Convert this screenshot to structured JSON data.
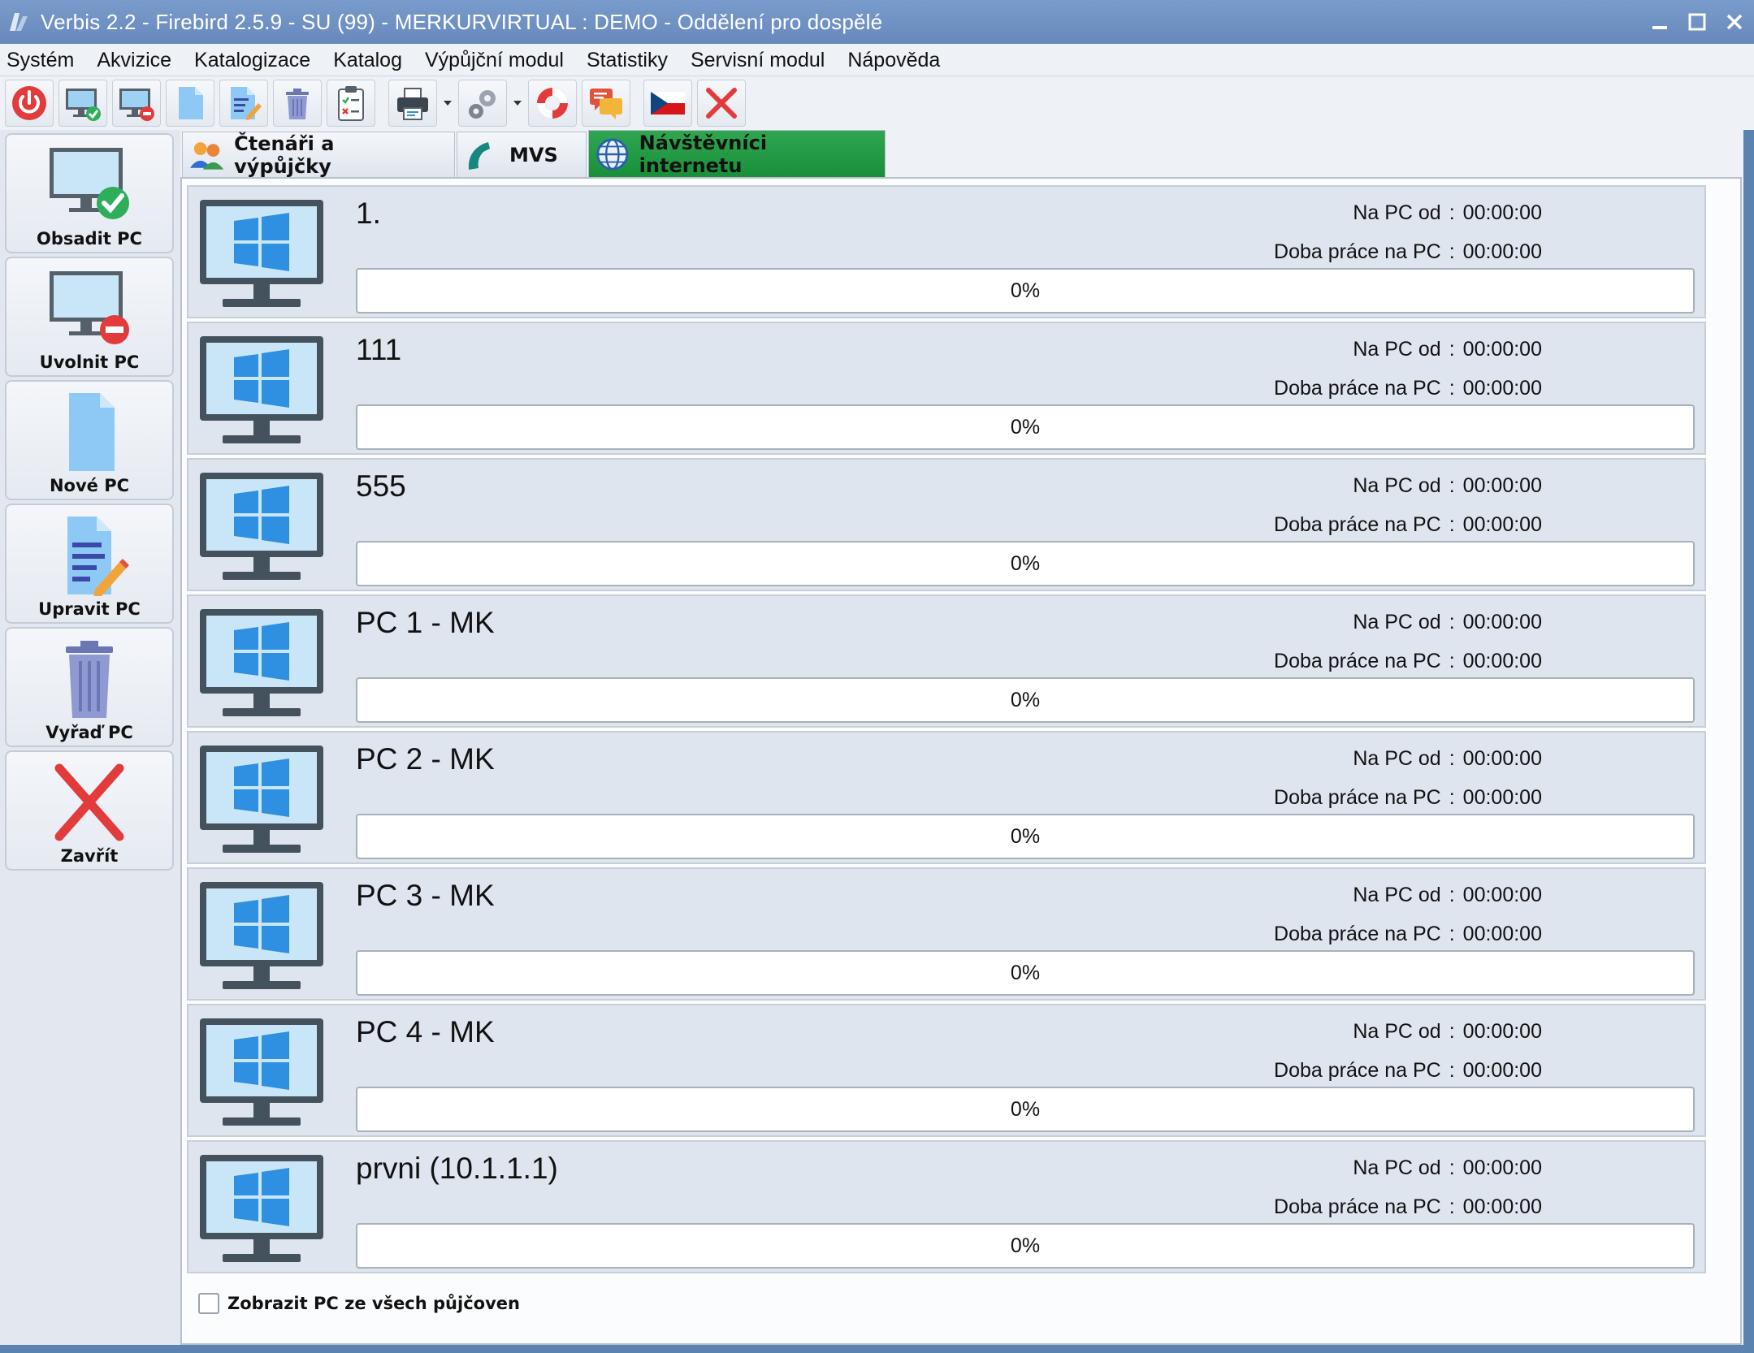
{
  "window": {
    "title": "Verbis 2.2 - Firebird 2.5.9 - SU (99) - MERKURVIRTUAL : DEMO - Oddělení pro dospělé"
  },
  "menu": [
    "Systém",
    "Akvizice",
    "Katalogizace",
    "Katalog",
    "Výpůjční modul",
    "Statistiky",
    "Servisní modul",
    "Nápověda"
  ],
  "toolbar_icons": [
    "power-icon",
    "monitor-ok-icon",
    "monitor-remove-icon",
    "new-document-icon",
    "edit-document-icon",
    "trash-icon",
    "clipboard-icon",
    "printer-icon",
    "settings-gear-icon",
    "lifebuoy-icon",
    "chat-icon",
    "czech-flag-icon",
    "close-red-x-icon"
  ],
  "sidebar": {
    "buttons": [
      {
        "label": "Obsadit PC",
        "icon": "monitor-check-icon"
      },
      {
        "label": "Uvolnit PC",
        "icon": "monitor-stop-icon"
      },
      {
        "label": "Nové PC",
        "icon": "new-document-icon"
      },
      {
        "label": "Upravit PC",
        "icon": "edit-document-icon"
      },
      {
        "label": "Vyřaď PC",
        "icon": "trash-icon"
      },
      {
        "label": "Zavřít",
        "icon": "close-red-x-icon"
      }
    ]
  },
  "tabs": [
    {
      "label": "Čtenáři a výpůjčky",
      "icon": "readers-icon",
      "active": false
    },
    {
      "label": "MVS",
      "icon": "phone-icon",
      "active": false
    },
    {
      "label": "Návštěvníci internetu",
      "icon": "globe-icon",
      "active": true
    }
  ],
  "pc_labels": {
    "since": "Na PC od",
    "duration": "Doba práce na PC",
    "separator": ":"
  },
  "pcs": [
    {
      "name": "1.",
      "since": "00:00:00",
      "duration": "00:00:00",
      "progress_text": "0%",
      "progress": 0
    },
    {
      "name": "111",
      "since": "00:00:00",
      "duration": "00:00:00",
      "progress_text": "0%",
      "progress": 0
    },
    {
      "name": "555",
      "since": "00:00:00",
      "duration": "00:00:00",
      "progress_text": "0%",
      "progress": 0
    },
    {
      "name": "PC 1 - MK",
      "since": "00:00:00",
      "duration": "00:00:00",
      "progress_text": "0%",
      "progress": 0
    },
    {
      "name": "PC 2 - MK",
      "since": "00:00:00",
      "duration": "00:00:00",
      "progress_text": "0%",
      "progress": 0
    },
    {
      "name": "PC 3 - MK",
      "since": "00:00:00",
      "duration": "00:00:00",
      "progress_text": "0%",
      "progress": 0
    },
    {
      "name": "PC 4 - MK",
      "since": "00:00:00",
      "duration": "00:00:00",
      "progress_text": "0%",
      "progress": 0
    },
    {
      "name": "prvni (10.1.1.1)",
      "since": "00:00:00",
      "duration": "00:00:00",
      "progress_text": "0%",
      "progress": 0
    }
  ],
  "footer": {
    "show_all_label": "Zobrazit PC ze všech půjčoven",
    "show_all_checked": false
  },
  "colors": {
    "titlebar": "#6f92c4",
    "active_tab": "#22a043",
    "monitor_blue": "#2f8fe0"
  }
}
